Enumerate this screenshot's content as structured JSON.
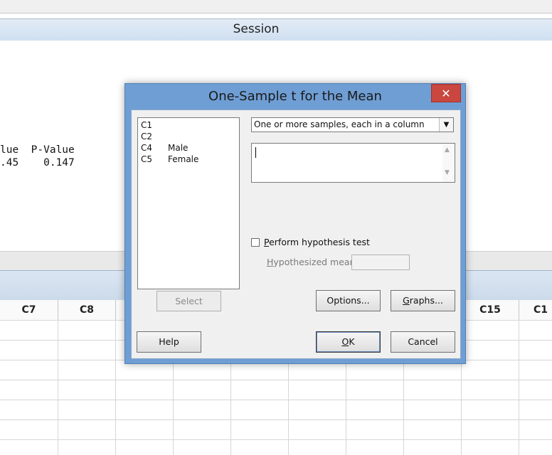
{
  "session": {
    "title": "Session",
    "output_headers": "lue  P-Value",
    "output_values": ".45    0.147"
  },
  "worksheet": {
    "columns": [
      "C7",
      "C8",
      "C15",
      "C1"
    ]
  },
  "dialog": {
    "title": "One-Sample t for the Mean",
    "close_glyph": "✕",
    "variables": [
      {
        "col": "C1",
        "name": ""
      },
      {
        "col": "C2",
        "name": ""
      },
      {
        "col": "C4",
        "name": "Male"
      },
      {
        "col": "C5",
        "name": "Female"
      }
    ],
    "select_button": "Select",
    "samples_dropdown": "One or more samples, each in a column",
    "samples_text_value": "",
    "hypothesis_checkbox": {
      "label_prefix": "P",
      "label_rest": "erform hypothesis test",
      "checked": false
    },
    "hypothesized_mean": {
      "label_prefix": "H",
      "label_rest": "ypothesized mean:",
      "value": ""
    },
    "buttons": {
      "options_prefix": "Options...",
      "graphs_prefix": "G",
      "graphs_rest": "raphs...",
      "help": "Help",
      "ok_prefix": "O",
      "ok_rest": "K",
      "cancel": "Cancel"
    }
  }
}
